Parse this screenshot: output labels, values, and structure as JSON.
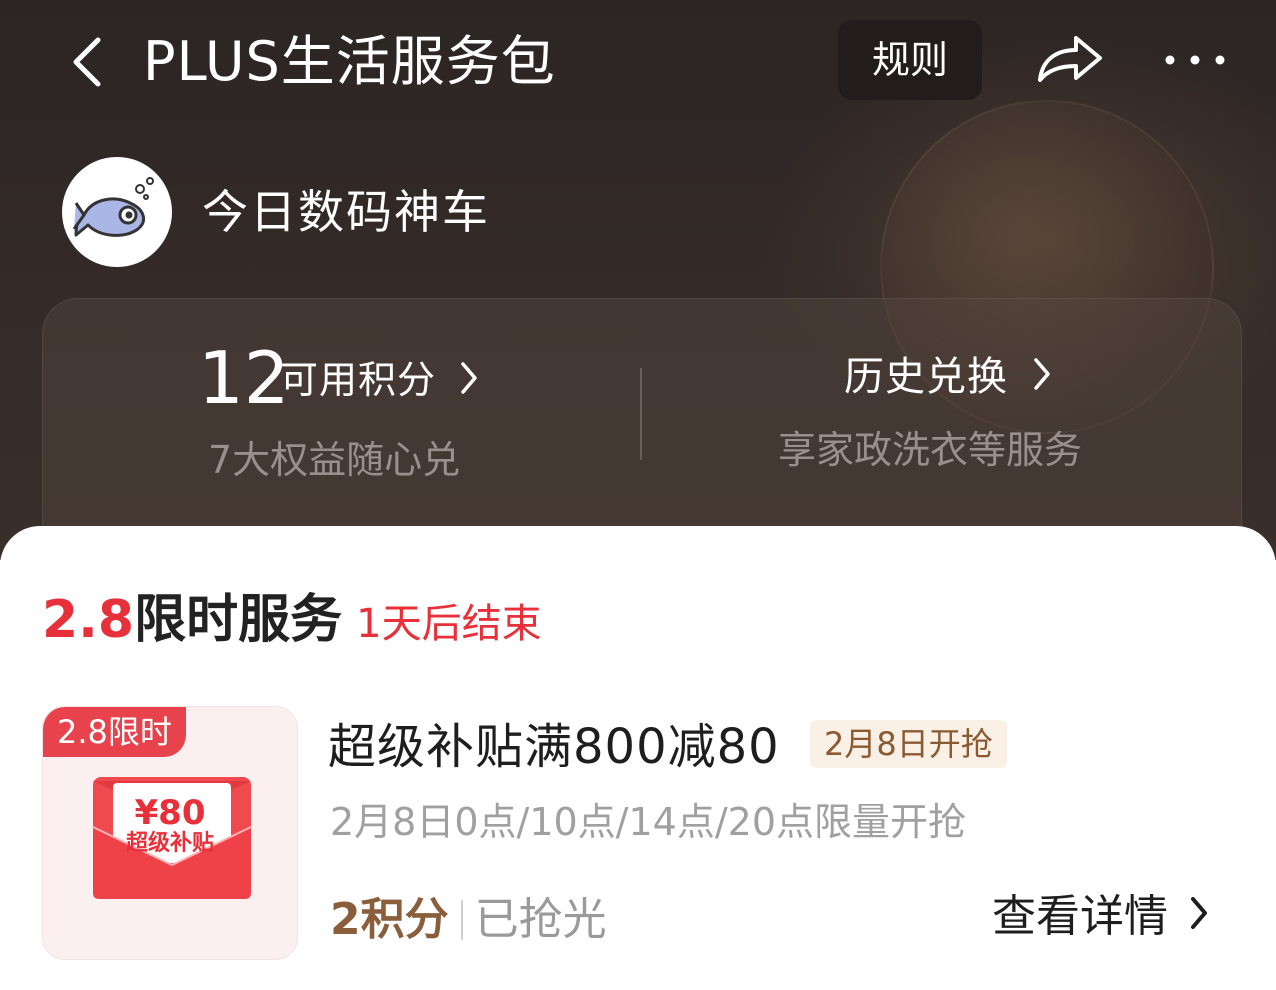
{
  "header": {
    "title": "PLUS生活服务包",
    "rules_label": "规则",
    "back_icon": "chevron-left-icon",
    "share_icon": "share-arrow-icon",
    "more_icon": "more-dots-icon"
  },
  "shop": {
    "name": "今日数码神车",
    "avatar_icon": "fish-logo"
  },
  "stats": {
    "points_value": "12",
    "points_label": "可用积分",
    "points_subtitle": "7大权益随心兑",
    "history_label": "历史兑换",
    "history_subtitle": "享家政洗衣等服务"
  },
  "section": {
    "date_label": "2.8",
    "title": "限时服务",
    "countdown": "1天后结束"
  },
  "item": {
    "thumb_tag": "2.8限时",
    "thumb_amount": "¥80",
    "thumb_caption": "超级补贴",
    "title": "超级补贴满800减80",
    "badge": "2月8日开抢",
    "description": "2月8日0点/10点/14点/20点限量开抢",
    "cost": "2积分",
    "status": "已抢光",
    "detail_label": "查看详情"
  },
  "colors": {
    "accent_red": "#e8303a",
    "cost_brown": "#8a5d3b",
    "badge_bg": "#fbf0e6",
    "hero_dark": "#2b2524"
  }
}
